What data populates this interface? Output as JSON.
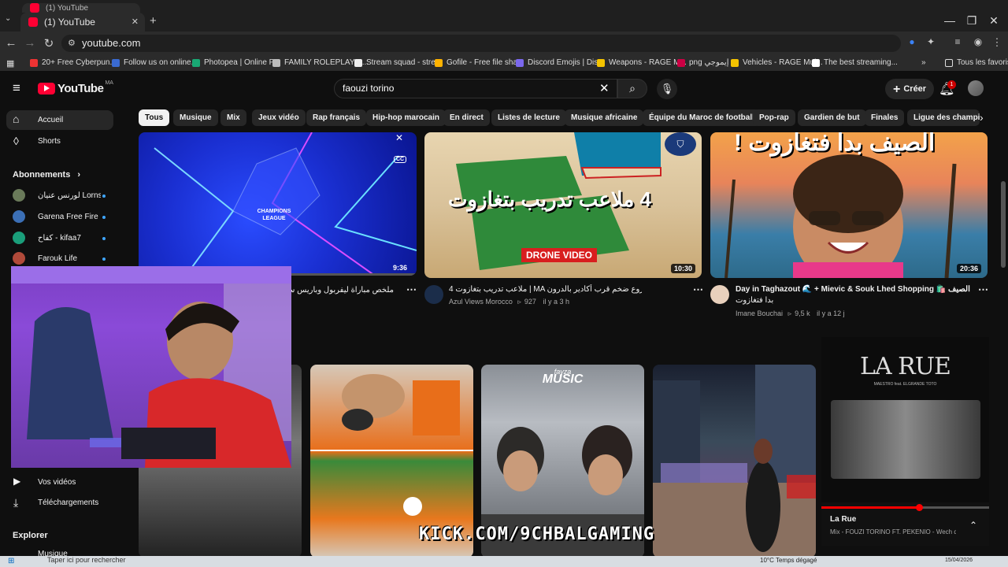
{
  "browser": {
    "tabs": [
      {
        "label": "(1) YouTube"
      },
      {
        "label": "(1) YouTube"
      }
    ],
    "new_tab": "+",
    "window_controls": {
      "minimize": "—",
      "restore": "❐",
      "close": "✕"
    },
    "url": "youtube.com",
    "bookmarks": [
      {
        "label": "20+ Free Cyberpun...",
        "color": "#e33"
      },
      {
        "label": "Follow us on online...",
        "color": "#3a6ad1"
      },
      {
        "label": "Photopea | Online P...",
        "color": "#19a974"
      },
      {
        "label": "FAMILY ROLEPLAY S...",
        "color": "#bbb"
      },
      {
        "label": "Stream squad - stre...",
        "color": "#eee"
      },
      {
        "label": "Gofile - Free file sha...",
        "color": "#ffb300"
      },
      {
        "label": "Discord Emojis | Dis...",
        "color": "#7b68ee"
      },
      {
        "label": "Weapons - RAGE M...",
        "color": "#f5c400"
      },
      {
        "label": "png إيموجي",
        "color": "#c04"
      },
      {
        "label": "Vehicles - RAGE Mul...",
        "color": "#f5c400"
      },
      {
        "label": "The best streaming...",
        "color": "#fff"
      }
    ],
    "all_favorites": "Tous les favoris"
  },
  "youtube": {
    "logo": "YouTube",
    "region": "MA",
    "search_value": "faouzi torino",
    "create_label": "Créer",
    "notif_count": "1",
    "chips": [
      "Tous",
      "Musique",
      "Mix",
      "Jeux vidéo",
      "Rap français",
      "Hip-hop marocain",
      "En direct",
      "Listes de lecture",
      "Musique africaine",
      "Équipe du Maroc de football",
      "Pop-rap",
      "Gardien de but",
      "Finales",
      "Ligue des champion"
    ]
  },
  "sidebar": {
    "home": "Accueil",
    "shorts": "Shorts",
    "subscriptions": "Abonnements",
    "subs": [
      {
        "name": "لورنس عنيان Lorns ...",
        "color": "#6a7a5a"
      },
      {
        "name": "Garena Free Fire ...",
        "color": "#3b6fb6"
      },
      {
        "name": "كفاح - kifaa7",
        "color": "#1a9e7a"
      },
      {
        "name": "Farouk Life",
        "color": "#b04a3a"
      }
    ],
    "your_videos": "Vos vidéos",
    "downloads": "Téléchargements",
    "explore": "Explorer",
    "music": "Musique"
  },
  "videos": [
    {
      "title": "ملخص مباراة ليفربول وباريس سان جيرمان",
      "duration": "9:36",
      "thumb_text": "CHAMPIONS LEAGUE"
    },
    {
      "title": "4 ملاعب تدريب بتغازوت | MA مشروع ضخم قرب أكادير بالدرون 🔴",
      "channel": "Azul Views Morocco",
      "views": "927",
      "age": "il y a 3 h",
      "duration": "10:30",
      "thumb_text": "4 ملاعب تدريب بتغازوت",
      "badge": "DRONE VIDEO"
    },
    {
      "title": "Day in Taghazout 🌊 + Mievic & Souk Lhed Shopping 🛍️ الصيف",
      "title2": "بدا فتغازوت",
      "channel": "Imane Bouchai",
      "views": "9,5 k",
      "age": "il y a 12 j",
      "duration": "20:36",
      "thumb_text": "الصيف بدا فتغازوت !"
    }
  ],
  "shorts_row": [
    {
      "label": ""
    },
    {
      "label": ""
    },
    {
      "label": "MUSIC",
      "top": "fayza"
    },
    {
      "label": ""
    }
  ],
  "miniplayer": {
    "art_title": "LA RUE",
    "art_sub": "MAESTRO feat. ELGRANDE TOTO",
    "title": "La Rue",
    "subtitle": "Mix - FOUZI TORINO FT. PEKENIO - Wech q...",
    "progress": 0.58
  },
  "overlay_text": "KICK.COM/9CHBALGAMING",
  "taskbar": {
    "search_placeholder": "Taper ici pour rechercher",
    "weather": "10°C  Temps dégagé",
    "date": "15/04/2026"
  }
}
